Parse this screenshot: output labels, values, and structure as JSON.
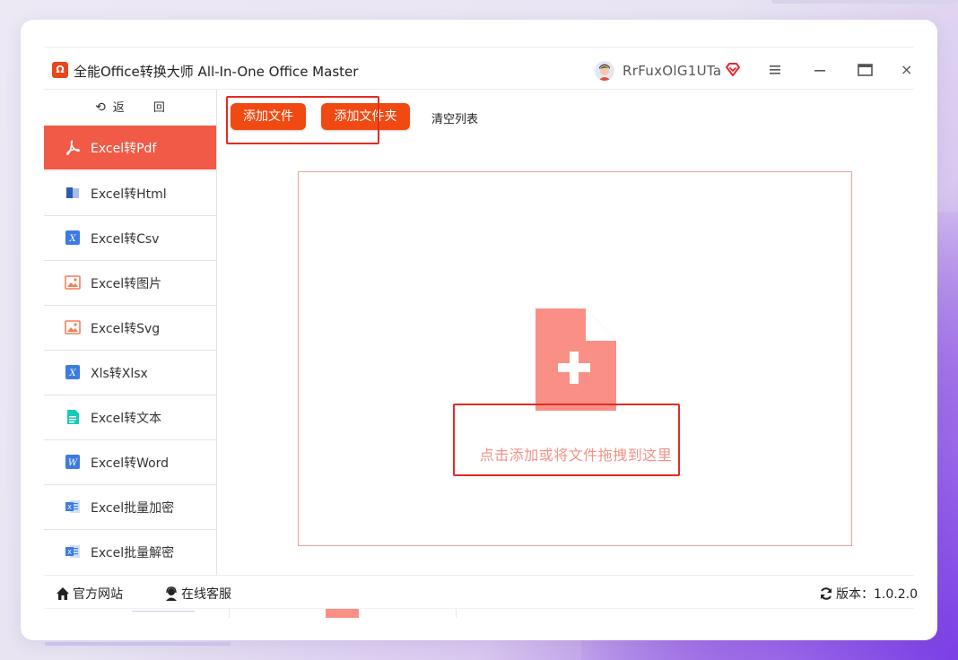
{
  "app": {
    "title": "全能Office转换大师 All-In-One Office Master",
    "logo_text": "Ω"
  },
  "user": {
    "name": "RrFuxOlG1UTa"
  },
  "window_controls": {
    "close_glyph": "×"
  },
  "sidebar": {
    "back_label": "返 回",
    "items": [
      {
        "label": "Excel转Pdf",
        "icon": "pdf-icon"
      },
      {
        "label": "Excel转Html",
        "icon": "html-book-icon"
      },
      {
        "label": "Excel转Csv",
        "icon": "excel-x-icon"
      },
      {
        "label": "Excel转图片",
        "icon": "image-icon"
      },
      {
        "label": "Excel转Svg",
        "icon": "image-icon"
      },
      {
        "label": "Xls转Xlsx",
        "icon": "excel-x-icon"
      },
      {
        "label": "Excel转文本",
        "icon": "text-doc-icon"
      },
      {
        "label": "Excel转Word",
        "icon": "word-icon"
      },
      {
        "label": "Excel批量加密",
        "icon": "excel-sheet-icon"
      },
      {
        "label": "Excel批量解密",
        "icon": "excel-sheet-icon"
      }
    ]
  },
  "toolbar": {
    "add_file": "添加文件",
    "add_folder": "添加文件夹",
    "clear_list": "清空列表"
  },
  "dropzone": {
    "hint": "点击添加或将文件拖拽到这里"
  },
  "footer": {
    "website": "官方网站",
    "support": "在线客服",
    "version": "版本：1.0.2.0"
  },
  "colors": {
    "accent": "#f04a12",
    "active_nav": "#f05a47",
    "highlight_box": "#e32b22",
    "drop_icon": "#fa8f86"
  }
}
